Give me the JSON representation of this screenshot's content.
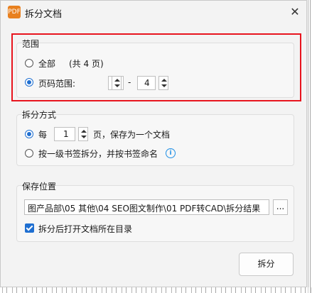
{
  "window": {
    "title": "拆分文档",
    "app_icon_text": "PDF",
    "close_glyph": "✕"
  },
  "range": {
    "section_label": "范围",
    "all_label": "全部",
    "page_count_note": "(共 4 页)",
    "page_range_label": "页码范围:",
    "from_value": "1",
    "dash": "-",
    "to_value": "4",
    "selected": "page_range"
  },
  "split_mode": {
    "section_label": "拆分方式",
    "every_label": "每",
    "every_value": "1",
    "every_suffix": "页，保存为一个文档",
    "bookmark_label": "按一级书签拆分，并按书签命名",
    "selected": "every"
  },
  "save": {
    "section_label": "保存位置",
    "path_value": "图产品部\\05  其他\\04  SEO图文制作\\01  PDF转CAD\\拆分结果",
    "browse_label": "...",
    "open_after_label": "拆分后打开文档所在目录",
    "open_after_checked": true
  },
  "actions": {
    "split_label": "拆分"
  },
  "colors": {
    "accent": "#1f6fd1",
    "highlight": "#e8141e",
    "info": "#1f8fe5",
    "icon_bg": "#e8801f"
  }
}
